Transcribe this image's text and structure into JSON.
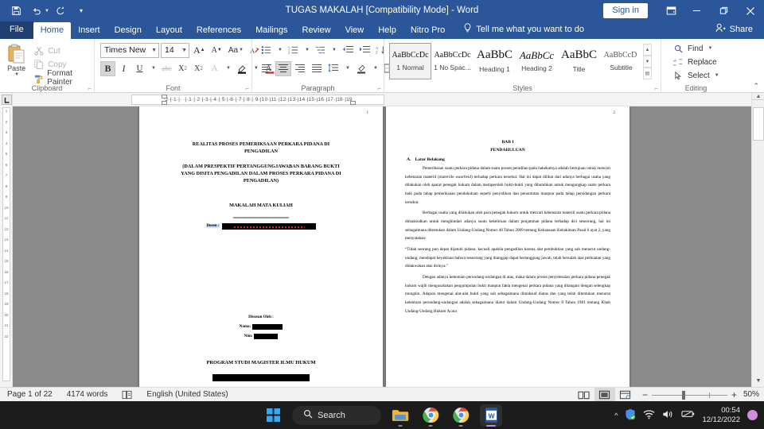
{
  "titlebar": {
    "document_title": "TUGAS MAKALAH [Compatibility Mode]  -  Word",
    "sign_in": "Sign in",
    "quick_access": [
      "save-icon",
      "undo-icon",
      "redo-icon",
      "customize-qat-icon"
    ],
    "window_controls": [
      "ribbon-display-options",
      "minimize",
      "restore",
      "close"
    ]
  },
  "ribbon_tabs": {
    "items": [
      "File",
      "Home",
      "Insert",
      "Design",
      "Layout",
      "References",
      "Mailings",
      "Review",
      "View",
      "Help",
      "Nitro Pro"
    ],
    "active": "Home",
    "tell_me": "Tell me what you want to do",
    "share": "Share"
  },
  "ribbon": {
    "clipboard": {
      "label": "Clipboard",
      "paste": "Paste",
      "cut": "Cut",
      "copy": "Copy",
      "format_painter": "Format Painter"
    },
    "font": {
      "label": "Font",
      "font_name": "Times New Ror",
      "font_size": "14",
      "buttons": [
        "grow-font",
        "shrink-font",
        "change-case",
        "clear-formatting",
        "bold",
        "italic",
        "underline",
        "strikethrough",
        "subscript",
        "superscript",
        "text-effects",
        "text-highlight-color",
        "font-color"
      ],
      "bold_active": true
    },
    "paragraph": {
      "label": "Paragraph",
      "buttons": [
        "bullets",
        "numbering",
        "multilevel-list",
        "decrease-indent",
        "increase-indent",
        "sort",
        "show-formatting-marks",
        "align-left",
        "align-center",
        "align-right",
        "justify",
        "line-spacing",
        "shading",
        "borders"
      ],
      "active_alignment": "align-center"
    },
    "styles": {
      "label": "Styles",
      "items": [
        {
          "preview": "AaBbCcDc",
          "name": "1 Normal",
          "selected": true
        },
        {
          "preview": "AaBbCcDc",
          "name": "1 No Spac...",
          "selected": false
        },
        {
          "preview": "AaBbC",
          "name": "Heading 1",
          "selected": false
        },
        {
          "preview": "AaBbCc",
          "name": "Heading 2",
          "selected": false
        },
        {
          "preview": "AaBbC",
          "name": "Title",
          "selected": false
        },
        {
          "preview": "AaBbCcD ",
          "name": "Subtitle",
          "selected": false
        }
      ]
    },
    "editing": {
      "label": "Editing",
      "find": "Find",
      "replace": "Replace",
      "select": "Select"
    }
  },
  "ruler": {
    "horizontal_marks": "·2·|·1·|·  ·|·1·|·2·|·3·|·4·|·5·|·6·|·7·|·8·|·9·|10·|11·|12·|13·|14·|15·|16·|17·|18·|19",
    "vertical_marks": [
      "1",
      "2",
      "3",
      "4",
      "5",
      "6",
      "7",
      "8",
      "9",
      "10",
      "11",
      "12",
      "13",
      "14",
      "15",
      "16",
      "17",
      "18",
      "19",
      "20",
      "21",
      "22"
    ],
    "tab_selector": "left-tab-stop"
  },
  "document": {
    "left_page": {
      "page_number": "1",
      "title_line1": "REALITAS PROSES PEMERIKSAAN PERKARA PIDANA DI",
      "title_line2": "PENGADILAN",
      "subtitle_line1": "(DALAM PRESPEKTIF PERTANGGUNGJAWABAN BARANG BUKTI",
      "subtitle_line2": "YANG DISITA PENGADILAN DALAM PROSES PERKARA PIDANA DI",
      "subtitle_line3": "PENGADILAN)",
      "course": "MAKALAH MATA KULIAH",
      "lecturer_label": "Dosen :",
      "lecturer_value": "[redacted]",
      "compiled_by": "Disusun Oleh :",
      "name_label": "Nama:",
      "name_value": "[redacted]",
      "nim_label": "Nim:",
      "nim_value": "[redacted]",
      "program": "PROGRAM STUDI MAGISTER ILMU HUKUM",
      "institution": "[redacted]",
      "year": "[redacted]"
    },
    "right_page": {
      "page_number": "2",
      "chapter": "BAB I",
      "chapter_title": "PENDAHULUAN",
      "section_letter": "A.",
      "section_title": "Latar Belakang",
      "paragraphs": [
        "Pemeriksaan suatu perkara pidana dalam suatu proses peradilan pada hakekatnya adalah bertujuan untuk mencari kebenaran materiil (materiile waarheid) terhadap perkara tersebut. Hal ini dapat dilihat dari adanya berbagai usaha yang dilakukan oleh aparat penegak hukum dalam memperoleh bukti-bukti yang dibutuhkan untuk mengungkap suatu perkara baik pada tahap pemeriksaan pendahuluan seperti penyidikan dan penuntutan maupun pada tahap persidangan perkara tersebut.",
        "Berbagai usaha yang dilakukan oleh para penegak hukum untuk mencari kebenaran materiil suatu perkara pidana dimaksudkan untuk menghindari adanya suatu kekeliruan dalam penjatuhan pidana terhadap diri seseorang, hal ini sebagaimana ditentukan dalam Undang-Undang Nomor 48 Tahun 2009 tentang Kekuasaan Kehakiman Pasal 6 ayat 2, yang menyatakan:",
        "“Tidak seorang pun dapat dijatuhi pidana, kecuali apabila pengadilan karena alat pembuktian yang sah menurut undang-undang, mendapat keyakinan bahwa seseorang yang dianggap dapat bertanggung jawab, telah bersalah atas perbuatan yang didakwakan atas dirinya.”",
        "Dengan adanya ketentuan perundang-undangan di atas, maka dalam proses penyelesaian perkara pidana penegak hukum wajib mengusahakan pengumpulan bukti maupun fakta mengenai perkara pidana yang ditangani dengan selengkap mungkin. Adapun mengenai alat-alat bukti yang sah sebagaimana dimaksud diatas dan yang telah ditentukan menurut ketentuan perundang-undangan adalah sebagaimana diatur dalam Undang-Undang Nomor 8 Tahun 1981 tentang Kitab Undang-Undang Hukum Acara"
      ]
    }
  },
  "status_bar": {
    "page_info": "Page 1 of 22",
    "word_count": "4174 words",
    "proofing_icon": "spelling-check-icon",
    "language": "English (United States)",
    "view_buttons": [
      "read-mode",
      "print-layout",
      "web-layout"
    ],
    "active_view": "print-layout",
    "zoom_out": "−",
    "zoom_in": "+",
    "zoom_level": "50%"
  },
  "taskbar": {
    "start": "start-icon",
    "search_placeholder": "Search",
    "apps": [
      "file-explorer-icon",
      "chrome-icon",
      "chrome-icon",
      "word-icon"
    ],
    "tray": [
      "show-hidden-icons",
      "security-icon",
      "wifi-icon",
      "volume-icon",
      "battery-icon"
    ],
    "time": "00:54",
    "date": "12/12/2022",
    "notification_count": ""
  },
  "colors": {
    "word_blue": "#2b579a",
    "file_tab": "#1e3f70",
    "accent_red": "#c0392b",
    "taskbar": "#1c1c1c"
  }
}
